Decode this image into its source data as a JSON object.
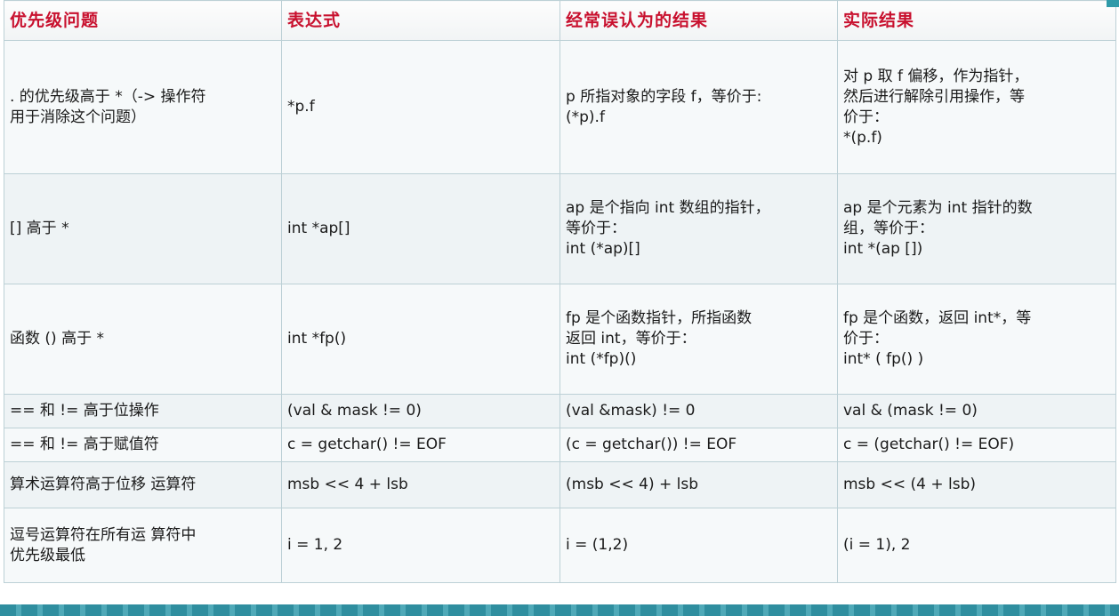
{
  "table": {
    "headers": [
      "优先级问题",
      "表达式",
      "经常误认为的结果",
      "实际结果"
    ],
    "rows": [
      {
        "issue": [
          ". 的优先级高于 *（-> 操作符",
          "用于消除这个问题）"
        ],
        "expr": [
          "*p.f"
        ],
        "mistaken": [
          "p 所指对象的字段 f，等价于:",
          "(*p).f"
        ],
        "actual": [
          "对 p 取 f 偏移，作为指针，",
          "然后进行解除引用操作，等",
          "价于：",
          "*(p.f)"
        ]
      },
      {
        "issue": [
          "[] 高于 *"
        ],
        "expr": [
          "int *ap[]"
        ],
        "mistaken": [
          "ap 是个指向 int 数组的指针，",
          "等价于：",
          "int (*ap)[]"
        ],
        "actual": [
          "ap 是个元素为 int 指针的数",
          "组，等价于：",
          "int *(ap [])"
        ]
      },
      {
        "issue": [
          "函数 () 高于 *"
        ],
        "expr": [
          "int *fp()"
        ],
        "mistaken": [
          "fp 是个函数指针，所指函数",
          "返回 int，等价于：",
          "int (*fp)()"
        ],
        "actual": [
          "fp 是个函数，返回 int*，等",
          "价于：",
          "int* ( fp() )"
        ]
      },
      {
        "issue": [
          "== 和 != 高于位操作"
        ],
        "expr": [
          "(val & mask != 0)"
        ],
        "mistaken": [
          "(val &mask) != 0"
        ],
        "actual": [
          "val & (mask != 0)"
        ]
      },
      {
        "issue": [
          "== 和 != 高于赋值符"
        ],
        "expr": [
          "c = getchar() != EOF"
        ],
        "mistaken": [
          "(c = getchar()) != EOF"
        ],
        "actual": [
          "c = (getchar() != EOF)"
        ]
      },
      {
        "issue": [
          "算术运算符高于位移 运算符"
        ],
        "expr": [
          "msb << 4 + lsb"
        ],
        "mistaken": [
          "(msb << 4) + lsb"
        ],
        "actual": [
          "msb << (4 + lsb)"
        ]
      },
      {
        "issue": [
          "逗号运算符在所有运 算符中",
          "优先级最低"
        ],
        "expr": [
          "i = 1, 2"
        ],
        "mistaken": [
          "i = (1,2)"
        ],
        "actual": [
          "(i = 1), 2"
        ]
      }
    ]
  },
  "colors": {
    "header_text": "#c8102e",
    "frame": "#1c7a8c"
  }
}
